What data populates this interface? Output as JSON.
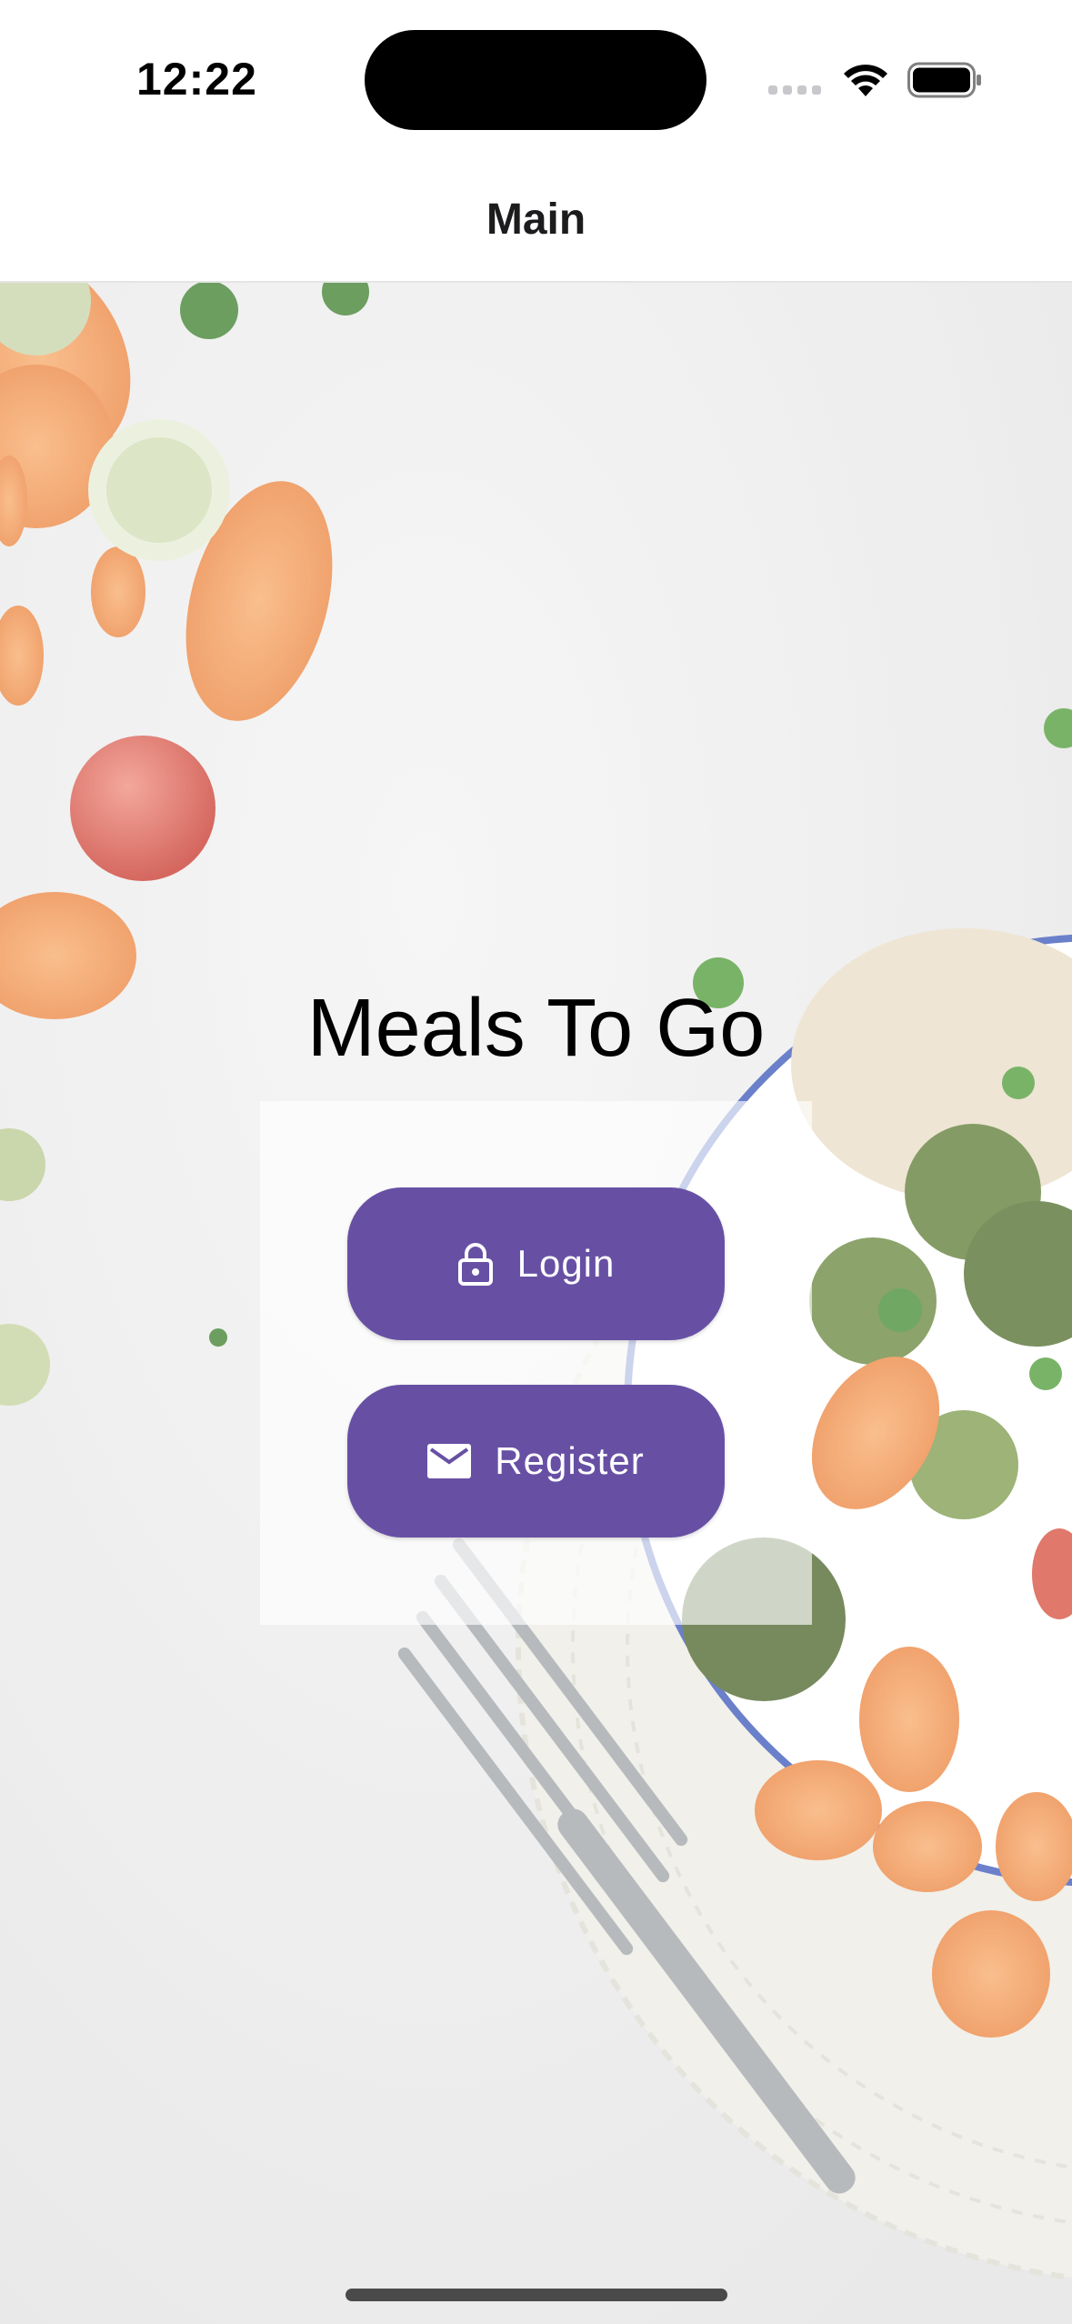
{
  "status_bar": {
    "time": "12:22",
    "wifi_icon": "wifi-icon",
    "battery_icon": "battery-icon",
    "signal_icon": "cellular-signal-icon"
  },
  "header": {
    "title": "Main"
  },
  "main": {
    "title": "Meals To Go",
    "login_label": "Login",
    "login_icon": "lock-icon",
    "register_label": "Register",
    "register_icon": "mail-icon"
  },
  "colors": {
    "primary": "#6750a4",
    "on_primary": "#ffffff",
    "header_text": "#1c1c1e"
  }
}
